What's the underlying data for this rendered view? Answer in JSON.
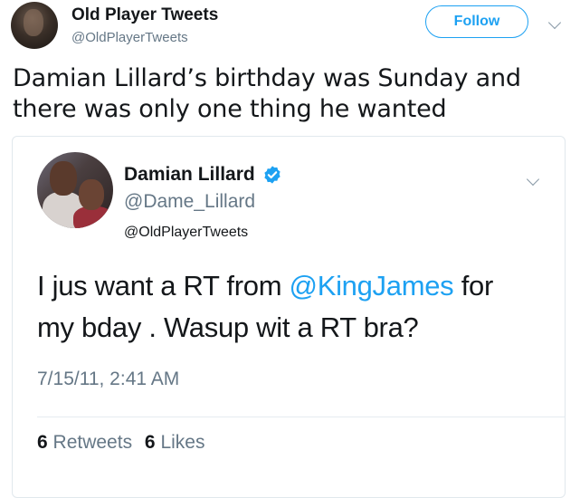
{
  "author": {
    "name": "Old Player Tweets",
    "handle": "@OldPlayerTweets"
  },
  "follow_label": "Follow",
  "tweet_text_line1": "Damian Lillard’s birthday was Sunday and",
  "tweet_text_line2": "there was only one thing he wanted",
  "quoted": {
    "name": "Damian Lillard",
    "handle": "@Dame_Lillard",
    "reply_to": "@OldPlayerTweets",
    "text_part1": "I jus want a RT from ",
    "mention": "@KingJames",
    "text_part2": " for",
    "text_line2": "my bday . Wasup wit a RT bra?",
    "timestamp": "7/15/11, 2:41 AM",
    "retweets_count": "6",
    "retweets_label": "Retweets",
    "likes_count": "6",
    "likes_label": "Likes"
  },
  "colors": {
    "accent": "#1da1f2",
    "secondary_text": "#657786",
    "primary_text": "#14171a"
  },
  "icons": {
    "verified": "verified-badge-icon",
    "menu": "chevron-down-icon"
  }
}
